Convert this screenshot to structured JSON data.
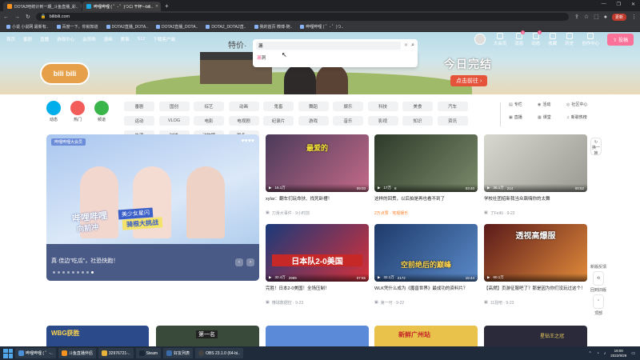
{
  "browser": {
    "tabs": [
      {
        "title": "DOTA2吧统计到一期_斗鱼直播_彩..",
        "active": false
      },
      {
        "title": "哔哩哔哩 ( ゜- ゜)つロ 干杯~-bili..",
        "active": true
      }
    ],
    "new_tab": "+",
    "window_controls": [
      "—",
      "❐",
      "✕"
    ],
    "url": "bilibili.com",
    "update_label": "更新",
    "bookmarks": [
      "小说 小说网 最新有..",
      "百度一下，你就知道",
      "DOTA2直播_DOTA..",
      "DOTA2直播_DOTA..",
      "DOTA2_DOTA2直..",
      "我的首页 微博-随..",
      "哔哩哔哩 ( ゜- ゜)つ.."
    ]
  },
  "topnav": {
    "left": [
      "首页",
      "番剧",
      "直播",
      "游戏中心",
      "会员购",
      "漫画",
      "赛事",
      "S12",
      "下载客户端"
    ],
    "right": [
      {
        "label": "大会员",
        "badge": ""
      },
      {
        "label": "消息",
        "badge": "4"
      },
      {
        "label": "动态",
        "badge": "1"
      },
      {
        "label": "收藏",
        "badge": ""
      },
      {
        "label": "历史",
        "badge": ""
      },
      {
        "label": "创作中心",
        "badge": ""
      }
    ],
    "upload_label": "投稿"
  },
  "search": {
    "value": "漏",
    "clear": "✕",
    "suggestion_highlight": "漏",
    "suggestion_rest": "洞"
  },
  "banner": {
    "calligraphy": "特价·",
    "headline": "今日完结",
    "button": "点击前往 ›",
    "logo": "bili bili",
    "sign": "2022"
  },
  "quick_links": [
    {
      "label": "动态",
      "color": "#00aeec"
    },
    {
      "label": "热门",
      "color": "#f25d59"
    },
    {
      "label": "频道",
      "color": "#39b54a"
    }
  ],
  "channels": [
    "番剧",
    "国创",
    "综艺",
    "动画",
    "鬼畜",
    "舞蹈",
    "娱乐",
    "科技",
    "美食",
    "汽车",
    "运动",
    "VLOG",
    "电影",
    "电视剧",
    "纪录片",
    "游戏",
    "音乐",
    "影视",
    "知识",
    "资讯",
    "生活",
    "时尚",
    "动物圈",
    "更多 ⌄"
  ],
  "side_links": [
    "专栏",
    "活动",
    "社区中心",
    "直播",
    "课堂",
    "新歌热榜"
  ],
  "carousel": {
    "tag": "哔哩哔哩大会员",
    "hearts": "♥♥♥♥",
    "title_line1": "哔哩哔哩",
    "title_line2": "美少女星闪",
    "title_line3": "骑根大挑战",
    "sub": "向前冲",
    "caption": "真·佳边\"吃瓜\"，社恐快跑！",
    "prev": "‹",
    "next": "›",
    "dots": 9,
    "active_dot": 8
  },
  "videos": [
    {
      "title": "xylar：翻车们玩命扶、找死卧槽！",
      "author": "刀滑大事件 · 9小时前",
      "views": "16.1万",
      "danmaku": "",
      "duration": "09:03",
      "overlay": "最爱的",
      "orange": false
    },
    {
      "title": "这样的回贯，以后拍是再也看不到了",
      "author": "2万点赞 · 宅观娱乐",
      "views": "17万",
      "danmaku": "8",
      "duration": "03:40",
      "overlay": "",
      "orange": true
    },
    {
      "title": "学校社团招新我当众飙嗨你的太舞",
      "author": "了FeiKi · 9-22",
      "views": "36.1万",
      "danmaku": "214",
      "duration": "00:52",
      "overlay": "",
      "orange": false
    },
    {
      "title": "完胜！日本2-0美国！全场压制！",
      "author": "懂球数据控 · 9-23",
      "views": "32.4万",
      "danmaku": "2989",
      "duration": "07:55",
      "overlay": "日本队2-0美国",
      "orange": false
    },
    {
      "title": "WLK凭什么成为《魔兽世界》最成功的资料片？",
      "author": "第一可 · 9-22",
      "views": "32.1万",
      "danmaku": "2172",
      "duration": "15:44",
      "overlay": "空前绝后的巅峰",
      "orange": false
    },
    {
      "title": "【高燃】页游征服吧了？那是因为你们没玩过这个！",
      "author": "11混吧 · 9-23",
      "views": "60.1万",
      "danmaku": "",
      "duration": "",
      "overlay": "透视高爆服",
      "orange": false
    }
  ],
  "side_float": {
    "refresh": "换一换",
    "new": "新版反馈",
    "old": "回到旧版",
    "top": "顶部"
  },
  "bottom_row_overlays": [
    "WBG获胜",
    "第一名",
    "",
    "新鲜广州站",
    "",
    "星钻王之冠"
  ],
  "taskbar": {
    "items": [
      "哔哩哔哩 ( ゜-..",
      "斗鱼直播伴侣",
      "32976721-..",
      "Steam",
      "好友列表",
      "OBS 23.1.0 (64-bi.."
    ],
    "time": "19:00",
    "date": "2022/9/29"
  },
  "colors": {
    "brand_pink": "#fb7299",
    "brand_blue": "#00aeec",
    "taskbar": "#1f2b3a"
  }
}
